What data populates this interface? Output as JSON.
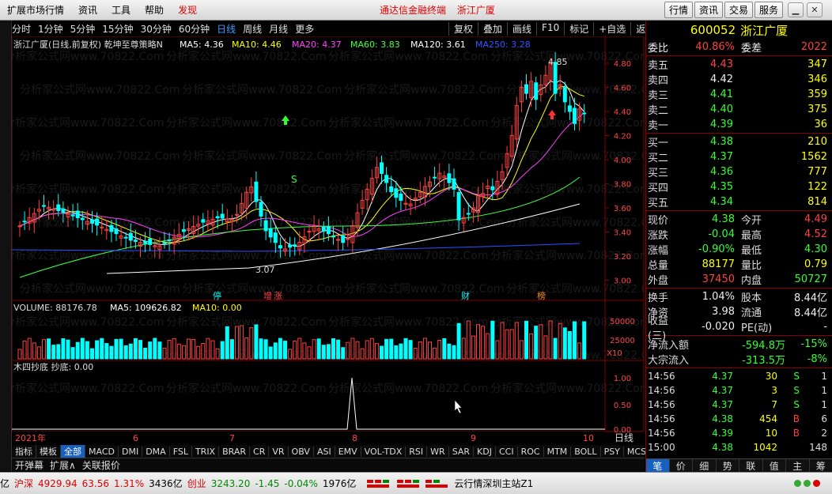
{
  "titlebar": {
    "menus": [
      "扩展市场行情",
      "资讯",
      "工具",
      "帮助",
      "发现"
    ],
    "center": [
      "通达信金融终端",
      "浙江广厦"
    ],
    "buttons": [
      "行情",
      "资讯",
      "交易",
      "服务"
    ]
  },
  "periods": [
    "分时",
    "1分钟",
    "5分钟",
    "15分钟",
    "30分钟",
    "60分钟",
    "日线",
    "周线",
    "月线",
    "更多"
  ],
  "active_period": "日线",
  "tools": [
    "复权",
    "叠加",
    "画线",
    "F10",
    "标记",
    "+自选",
    "返回"
  ],
  "main_legend": {
    "name": "浙江广厦(日线,前复权) 乾坤至尊策略N",
    "ma5": "MA5: 4.36",
    "ma10": "MA10: 4.46",
    "ma20": "MA20: 4.37",
    "ma60": "MA60: 3.83",
    "ma120": "MA120: 3.61",
    "ma250": "MA250: 3.28"
  },
  "price_axis": [
    "4.80",
    "4.60",
    "4.40",
    "4.20",
    "4.00",
    "3.80",
    "3.60",
    "3.40",
    "3.20",
    "3.00"
  ],
  "annotations": {
    "high": "4.85",
    "low": "3.07",
    "s_mark": "S"
  },
  "event_marks": [
    "停",
    "增",
    "涨",
    "财",
    "榜"
  ],
  "volume_legend": {
    "label": "VOLUME: 88176.78",
    "ma5": "MA5: 109626.82",
    "ma10": "MA10: 0.00"
  },
  "volume_axis": [
    "50000",
    "25000",
    "X10"
  ],
  "sub_legend": "木四抄底 抄底: 0.00",
  "sub_axis": [
    "1.00",
    "0.50",
    "0.00"
  ],
  "date_axis": {
    "year": "2021年",
    "months": [
      "6",
      "7",
      "8",
      "9",
      "10"
    ]
  },
  "period_label": "日线",
  "indicator_tabs": [
    "指标",
    "模板",
    "全部",
    "MACD",
    "DMI",
    "DMA",
    "FSL",
    "TRIX",
    "BRAR",
    "CR",
    "VR",
    "OBV",
    "ASI",
    "EMV",
    "VOL-TDX",
    "RSI",
    "WR",
    "SAR",
    "KDJ",
    "CCI",
    "ROC",
    "MTM",
    "BOLL",
    "PSY",
    "MCST"
  ],
  "ext_tabs": [
    "开弹幕",
    "扩展∧",
    "关联报价"
  ],
  "stock": {
    "code": "600052",
    "name": "浙江广厦"
  },
  "order": {
    "ratio_label": "委比",
    "ratio": "40.86%",
    "diff_label": "委差",
    "diff": "2022",
    "asks": [
      [
        "卖五",
        "4.43",
        "347"
      ],
      [
        "卖四",
        "4.42",
        "346"
      ],
      [
        "卖三",
        "4.41",
        "359"
      ],
      [
        "卖二",
        "4.40",
        "375"
      ],
      [
        "卖一",
        "4.39",
        "36"
      ]
    ],
    "bids": [
      [
        "买一",
        "4.38",
        "210"
      ],
      [
        "买二",
        "4.37",
        "1562"
      ],
      [
        "买三",
        "4.36",
        "777"
      ],
      [
        "买四",
        "4.35",
        "122"
      ],
      [
        "买五",
        "4.34",
        "814"
      ]
    ]
  },
  "quote": [
    [
      "现价",
      "4.38",
      "今开",
      "4.49"
    ],
    [
      "涨跌",
      "-0.04",
      "最高",
      "4.52"
    ],
    [
      "涨幅",
      "-0.90%",
      "最低",
      "4.30"
    ],
    [
      "总量",
      "88177",
      "量比",
      "0.79"
    ],
    [
      "外盘",
      "37450",
      "内盘",
      "50727"
    ]
  ],
  "finance": [
    [
      "换手",
      "1.04%",
      "股本",
      "8.44亿"
    ],
    [
      "净资",
      "3.98",
      "流通",
      "8.44亿"
    ],
    [
      "收益(三)",
      "-0.020",
      "PE(动)",
      "-"
    ]
  ],
  "flow": [
    [
      "净流入额",
      "-594.8万",
      "-15%"
    ],
    [
      "大宗流入",
      "-313.5万",
      "-8%"
    ]
  ],
  "trades": [
    [
      "14:56",
      "4.37",
      "30",
      "S",
      "1"
    ],
    [
      "14:56",
      "4.37",
      "3",
      "S",
      "1"
    ],
    [
      "14:56",
      "4.37",
      "7",
      "S",
      "1"
    ],
    [
      "14:56",
      "4.38",
      "454",
      "B",
      "6"
    ],
    [
      "14:56",
      "4.39",
      "10",
      "B",
      "2"
    ],
    [
      "15:00",
      "4.38",
      "1042",
      "",
      "148"
    ]
  ],
  "right_tabs": [
    "笔",
    "价",
    "细",
    "势",
    "联",
    "值",
    "主",
    "筹"
  ],
  "status": {
    "idx1": "亿",
    "sh": "沪深",
    "sh_val": "4929.94",
    "sh_chg": "63.56",
    "sh_pct": "1.31%",
    "sh_amt": "3436亿",
    "cy": "创业",
    "cy_val": "3243.20",
    "cy_chg": "-1.45",
    "cy_pct": "-0.04%",
    "cy_amt": "1976亿",
    "server": "云行情深圳主站Z1"
  },
  "watermark": "分析家公式网www.70822.Com",
  "colors": {
    "up": "#ff4040",
    "down": "#00ffff",
    "ma5": "#ffffff",
    "ma10": "#ffff00",
    "ma20": "#ff40ff",
    "ma60": "#40ff40",
    "ma120": "#ffffff",
    "ma250": "#3050ff"
  }
}
